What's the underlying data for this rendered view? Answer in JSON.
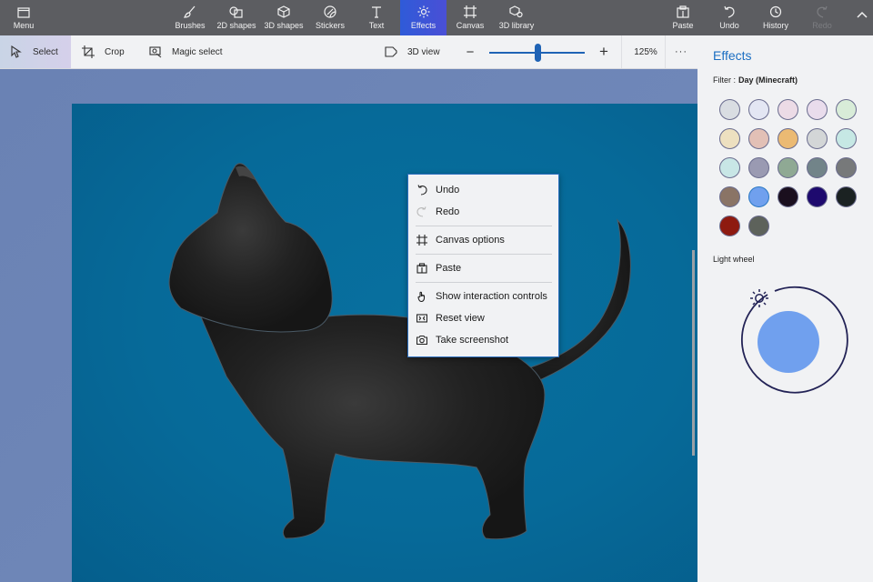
{
  "topbar": {
    "menu": {
      "label": "Menu",
      "icon": "folder-icon"
    },
    "tools": [
      {
        "label": "Brushes",
        "icon": "brush-icon"
      },
      {
        "label": "2D shapes",
        "icon": "2d-shapes-icon"
      },
      {
        "label": "3D shapes",
        "icon": "cube-icon"
      },
      {
        "label": "Stickers",
        "icon": "sticker-icon"
      },
      {
        "label": "Text",
        "icon": "text-icon"
      },
      {
        "label": "Effects",
        "icon": "sun-icon",
        "active": true
      },
      {
        "label": "Canvas",
        "icon": "canvas-icon"
      },
      {
        "label": "3D library",
        "icon": "3d-library-icon"
      }
    ],
    "actions": [
      {
        "label": "Paste",
        "icon": "paste-icon"
      },
      {
        "label": "Undo",
        "icon": "undo-icon"
      },
      {
        "label": "History",
        "icon": "history-icon"
      },
      {
        "label": "Redo",
        "icon": "redo-icon",
        "disabled": true
      }
    ],
    "collapse_icon": "chevron-up-icon"
  },
  "subbar": {
    "select": "Select",
    "crop": "Crop",
    "magic_select": "Magic select",
    "view_3d": "3D view",
    "zoom_minus": "−",
    "zoom_plus": "+",
    "zoom_level": "125%",
    "zoom_slider_fraction": 0.5,
    "more": "···"
  },
  "context_menu": {
    "items": [
      {
        "label": "Undo",
        "icon": "undo-icon"
      },
      {
        "label": "Redo",
        "icon": "redo-icon",
        "disabled": true
      },
      {
        "label": "Canvas options",
        "icon": "canvas-icon"
      },
      {
        "label": "Paste",
        "icon": "paste-icon"
      },
      {
        "label": "Show interaction controls",
        "icon": "hand-icon"
      },
      {
        "label": "Reset view",
        "icon": "reset-view-icon"
      },
      {
        "label": "Take screenshot",
        "icon": "camera-icon"
      }
    ]
  },
  "panel": {
    "title": "Effects",
    "filter_label": "Filter :",
    "filter_value": "Day (Minecraft)",
    "swatches": [
      "#d9dde2",
      "#e3e6f3",
      "#ecdbe6",
      "#e9dcec",
      "#d8ecd8",
      "#ede0c0",
      "#e2c0b6",
      "#ebba73",
      "#d3d6d7",
      "#c6e8e4",
      "#c8e6e6",
      "#9a9ab2",
      "#8fa994",
      "#728489",
      "#77797a",
      "#8a7466",
      "#70a0ee",
      "#1a0f1e",
      "#1e0a6e",
      "#1b2222",
      "#8e1a10",
      "#5d625b"
    ],
    "selected_swatch": 16,
    "light_wheel_label": "Light wheel",
    "light_color": "#70a0ee"
  }
}
